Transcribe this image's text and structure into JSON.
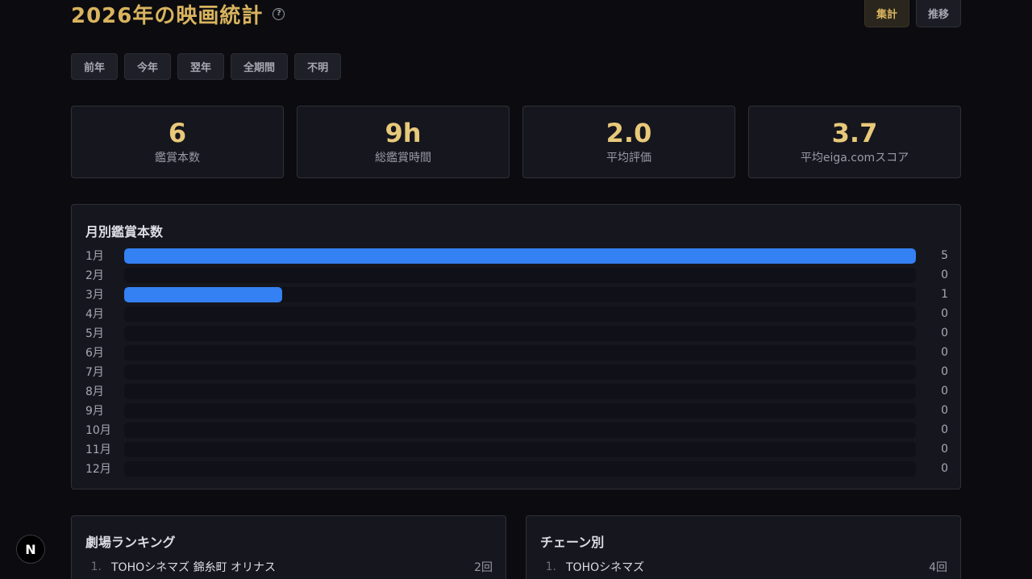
{
  "header": {
    "title": "2026年の映画統計",
    "help_icon": "?",
    "view_tabs": [
      {
        "label": "集計",
        "active": true
      },
      {
        "label": "推移",
        "active": false
      }
    ]
  },
  "year_filter": [
    "前年",
    "今年",
    "翌年",
    "全期間",
    "不明"
  ],
  "stats": [
    {
      "value": "6",
      "label": "鑑賞本数"
    },
    {
      "value": "9h",
      "label": "総鑑賞時間"
    },
    {
      "value": "2.0",
      "label": "平均評価"
    },
    {
      "value": "3.7",
      "label": "平均eiga.comスコア"
    }
  ],
  "monthly": {
    "title": "月別鑑賞本数",
    "bar_color": "#3381f2"
  },
  "chart_data": {
    "type": "bar",
    "orientation": "horizontal",
    "title": "月別鑑賞本数",
    "categories": [
      "1月",
      "2月",
      "3月",
      "4月",
      "5月",
      "6月",
      "7月",
      "8月",
      "9月",
      "10月",
      "11月",
      "12月"
    ],
    "values": [
      5,
      0,
      1,
      0,
      0,
      0,
      0,
      0,
      0,
      0,
      0,
      0
    ],
    "xlim": [
      0,
      5
    ]
  },
  "theater_ranking": {
    "title": "劇場ランキング",
    "items": [
      {
        "rank": "1.",
        "name": "TOHOシネマズ 錦糸町 オリナス",
        "count": "2回"
      }
    ]
  },
  "chain_ranking": {
    "title": "チェーン別",
    "items": [
      {
        "rank": "1.",
        "name": "TOHOシネマズ",
        "count": "4回"
      }
    ]
  },
  "badge": {
    "label": "N"
  },
  "colors": {
    "accent": "#d9b45e",
    "value": "#e8c97a",
    "background": "#0b0b10",
    "card": "#16161e"
  }
}
